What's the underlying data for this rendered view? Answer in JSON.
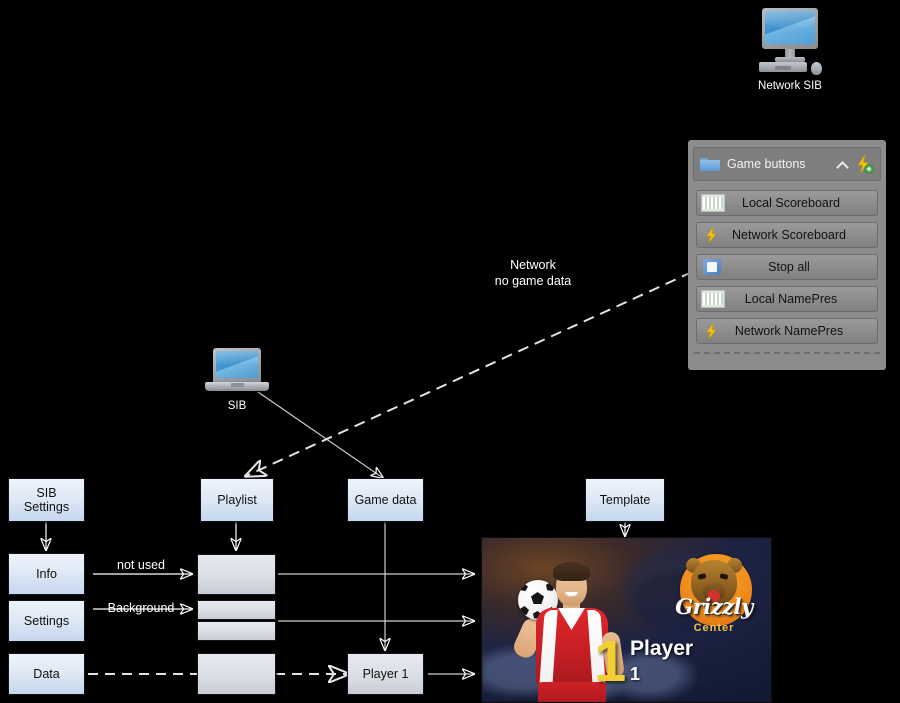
{
  "icons": {
    "network_sib": {
      "label": "Network SIB"
    },
    "sib_laptop": {
      "label": "SIB"
    }
  },
  "annotations": {
    "network_no_game_data": "Network\nno game data",
    "not_used": "not used",
    "background": "Background"
  },
  "game_buttons_panel": {
    "title": "Game buttons",
    "collapse_icon": "chevron-up-icon",
    "add_icon": "lightning-add-icon",
    "folder_icon": "folder-icon",
    "buttons": [
      {
        "label": "Local Scoreboard",
        "icon": "scoreboard-icon"
      },
      {
        "label": "Network Scoreboard",
        "icon": "lightning-icon"
      },
      {
        "label": "Stop all",
        "icon": "stop-icon"
      },
      {
        "label": "Local NamePres",
        "icon": "scoreboard-icon"
      },
      {
        "label": "Network NamePres",
        "icon": "lightning-icon"
      }
    ]
  },
  "nodes": {
    "sib_settings": "SIB\nSettings",
    "info": "Info",
    "settings": "Settings",
    "data": "Data",
    "playlist": "Playlist",
    "game_data": "Game data",
    "player_1": "Player 1",
    "template": "Template"
  },
  "preview": {
    "logo_script": "Grizzly",
    "logo_subtitle": "Center",
    "player_number_big": "1",
    "player_name": "Player",
    "player_number": "1"
  },
  "colors": {
    "box_blue": "#c5d7ee",
    "box_grey": "#c8ccd3",
    "panel_grey": "#8c8c8c",
    "accent_yellow": "#f0cf33",
    "logo_orange": "#ef8c1c",
    "jersey_red": "#c61f24",
    "background": "#000000"
  }
}
